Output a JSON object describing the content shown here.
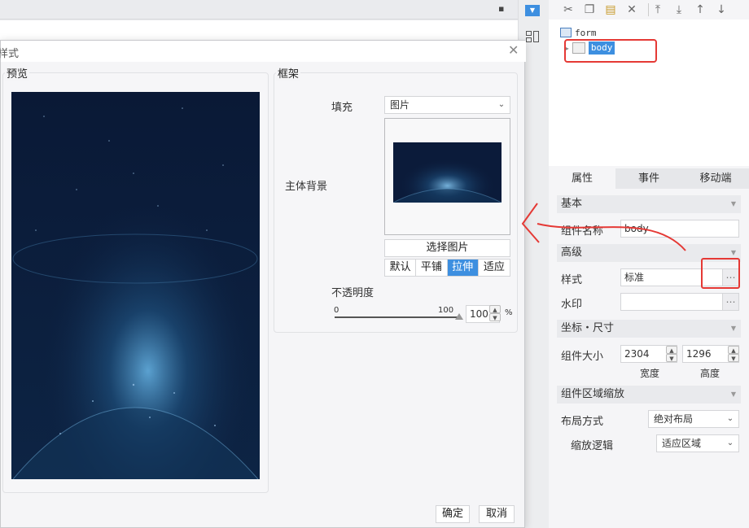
{
  "dialog": {
    "title": "样式",
    "preview_label": "预览",
    "frame_label": "框架",
    "fill_label": "填充",
    "fill_value": "图片",
    "main_bg_label": "主体背景",
    "choose_image_label": "选择图片",
    "fit_modes": [
      "默认",
      "平铺",
      "拉伸",
      "适应"
    ],
    "fit_mode_selected": "拉伸",
    "opacity_label": "不透明度",
    "opacity_min": "0",
    "opacity_max": "100",
    "opacity_value": "100",
    "opacity_unit": "%",
    "confirm_label": "确定",
    "cancel_label": "取消"
  },
  "tree": {
    "form_label": "form",
    "body_label": "body"
  },
  "tabs": [
    "属性",
    "事件",
    "移动端"
  ],
  "active_tab": "属性",
  "props": {
    "basic_header": "基本",
    "component_name_label": "组件名称",
    "component_name_value": "body",
    "advanced_header": "高级",
    "style_label": "样式",
    "style_value": "标准",
    "dots": "…",
    "watermark_label": "水印",
    "watermark_value": "",
    "coord_header": "坐标・尺寸",
    "size_label": "组件大小",
    "width_value": "2304",
    "height_value": "1296",
    "width_label": "宽度",
    "height_label": "高度",
    "zoom_header": "组件区域缩放",
    "layout_label": "布局方式",
    "layout_value": "绝对布局",
    "scale_logic_label": "缩放逻辑",
    "scale_logic_value": "适应区域"
  },
  "icons": {
    "cut": "scissors-icon",
    "copy": "copy-icon",
    "paste": "paste-icon",
    "delete": "delete-icon",
    "move_top": "move-to-top-icon",
    "move_bottom": "move-to-bottom-icon",
    "move_up": "move-up-icon",
    "move_down": "move-down-icon"
  },
  "colors": {
    "accent": "#3d8fe0",
    "annotation": "#e53935",
    "starfield": "#0b1b3a"
  }
}
